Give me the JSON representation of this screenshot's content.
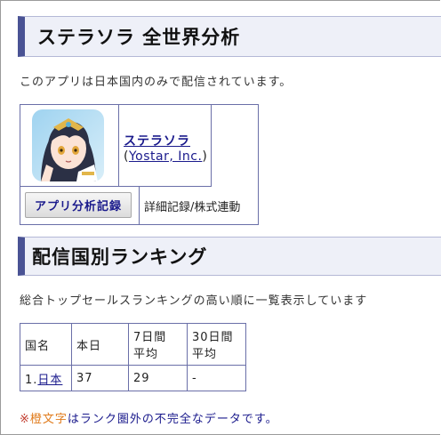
{
  "page": {
    "title": "ステラソラ 全世界分析",
    "availability_note": "このアプリは日本国内のみで配信されています。"
  },
  "app": {
    "name": "ステラソラ",
    "dev_open": "(",
    "developer": "Yostar, Inc.",
    "dev_close": ")",
    "icon_name": "app-icon-character"
  },
  "actions": {
    "analysis_button": "アプリ分析記録",
    "detail_link": "詳細記録/株式連動"
  },
  "ranking": {
    "title": "配信国別ランキング",
    "description": "総合トップセールスランキングの高い順に一覧表示しています",
    "headers": {
      "country": "国名",
      "today": "本日",
      "week_l1": "7日間",
      "week_l2": "平均",
      "month_l1": "30日間",
      "month_l2": "平均"
    },
    "rows": [
      {
        "rank": "1.",
        "country": "日本",
        "today": "37",
        "week": "29",
        "month": "-"
      }
    ]
  },
  "footnote": {
    "mark": "※",
    "orange": "橙文字",
    "rest": "はランク圏外の不完全なデータです。"
  },
  "colors": {
    "accent": "#4a5394",
    "link": "#1a1a8c",
    "orange": "#e07a1a"
  }
}
